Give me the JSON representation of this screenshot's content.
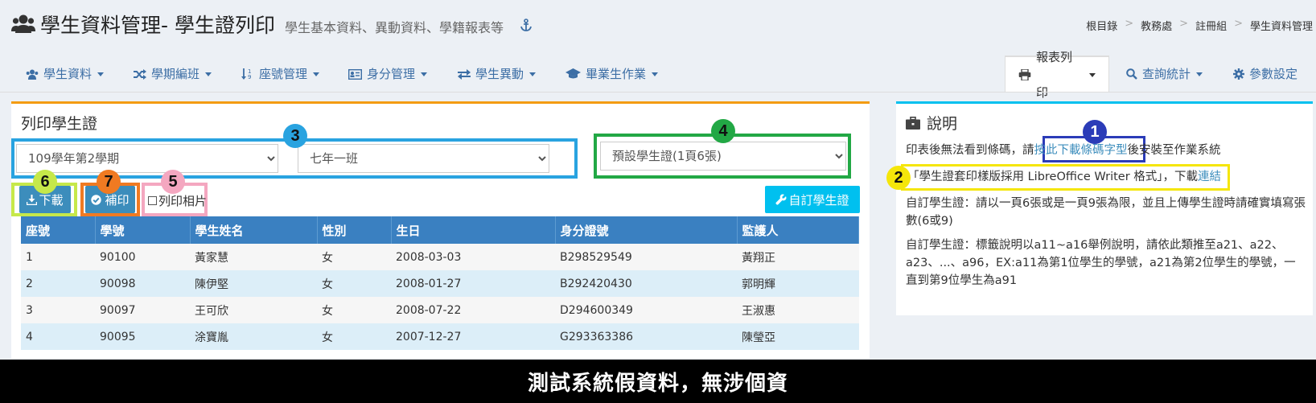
{
  "header": {
    "title": "學生資料管理- 學生證列印",
    "subtitle": "學生基本資料、異動資料、學籍報表等",
    "breadcrumb": [
      "根目錄",
      "教務處",
      "註冊組",
      "學生資料管理"
    ]
  },
  "nav": {
    "items": [
      "學生資料",
      "學期編班",
      "座號管理",
      "身分管理",
      "學生異動",
      "畢業生作業"
    ],
    "right_items": [
      "報表列印",
      "查詢統計",
      "參數設定"
    ],
    "active": "報表列印"
  },
  "print_panel": {
    "title": "列印學生證",
    "semester_select": "109學年第2學期",
    "class_select": "七年一班",
    "template_select": "預設學生證(1頁6張)",
    "download_label": "下載",
    "reprint_label": "補印",
    "photo_checkbox_label": "列印相片",
    "custom_button_label": "自訂學生證"
  },
  "annotations": {
    "badges": [
      "1",
      "2",
      "3",
      "4",
      "5",
      "6",
      "7"
    ],
    "colors": {
      "1": "#2b3cb8",
      "2": "#f5e60a",
      "3": "#29a3e0",
      "4": "#22a845",
      "5": "#f4a7c0",
      "6": "#c6e84a",
      "7": "#f07a22"
    }
  },
  "table": {
    "columns": [
      "座號",
      "學號",
      "學生姓名",
      "性別",
      "生日",
      "身分證號",
      "監護人"
    ],
    "rows": [
      [
        "1",
        "90100",
        "黃家慧",
        "女",
        "2008-03-03",
        "B298529549",
        "黃翔正"
      ],
      [
        "2",
        "90098",
        "陳伊堅",
        "女",
        "2008-01-27",
        "B292420430",
        "郭明輝"
      ],
      [
        "3",
        "90097",
        "王可欣",
        "女",
        "2008-07-22",
        "D294600349",
        "王淑惠"
      ],
      [
        "4",
        "90095",
        "涂寶胤",
        "女",
        "2007-12-27",
        "G293363386",
        "陳瑩亞"
      ]
    ]
  },
  "help_panel": {
    "title": "說明",
    "line1_prefix": "印表後無法看到條碼，請",
    "line1_link": "按此下載條碼字型",
    "line1_suffix": "後安裝至作業系統",
    "line2_text": "「學生證套印樣版採用 LibreOffice Writer 格式」，下載",
    "line2_link": "連結",
    "line3": "自訂學生證：請以一頁6張或是一頁9張為限，並且上傳學生證時請確實填寫張數(6或9)",
    "line4": "自訂學生證：標籤說明以a11~a16舉例說明，請依此類推至a21、a22、a23、...、a96，EX:a11為第1位學生的學號，a21為第2位學生的學號，一直到第9位學生為a91"
  },
  "footer_text": "測試系統假資料，無涉個資"
}
